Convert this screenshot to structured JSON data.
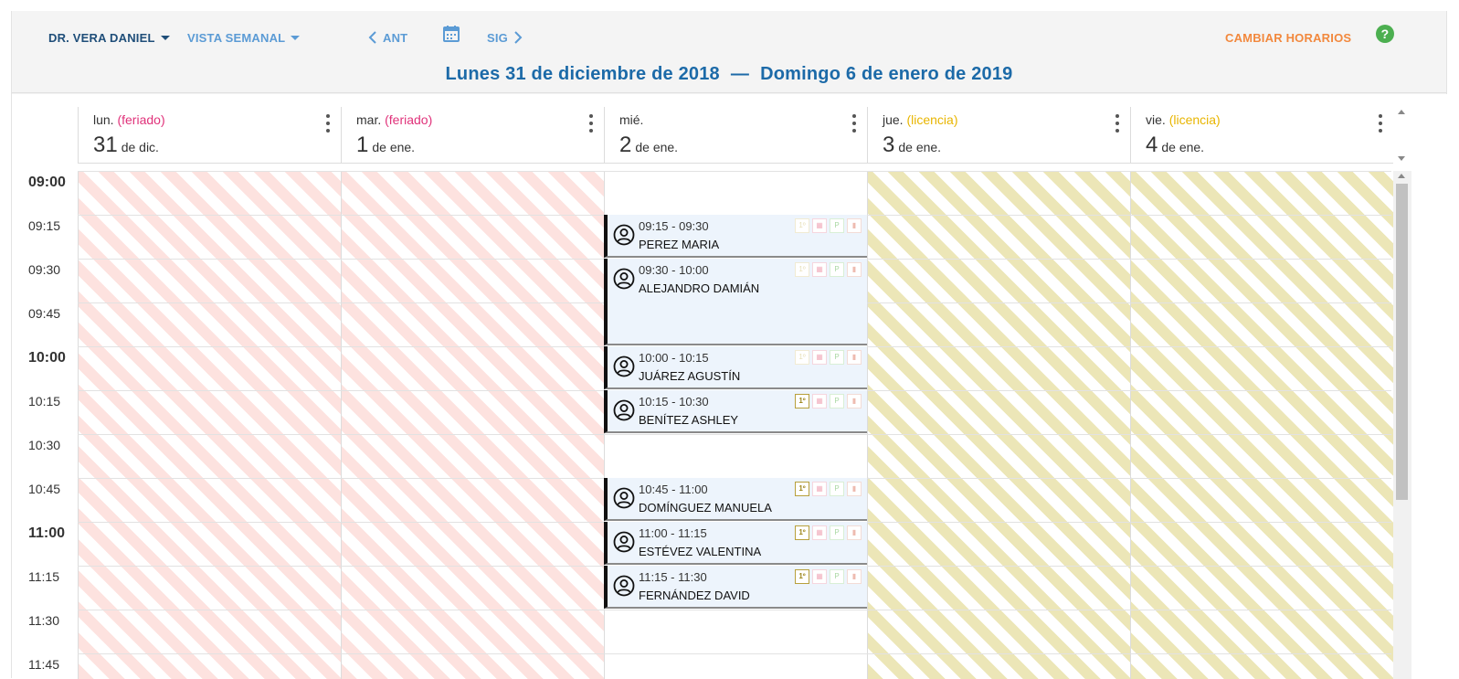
{
  "toolbar": {
    "doctor": "DR. VERA DANIEL",
    "view": "VISTA SEMANAL",
    "prev": "ANT",
    "next": "SIG",
    "change_schedules": "CAMBIAR HORARIOS",
    "help_icon": "question-circle-icon",
    "calendar_icon": "calendar-icon"
  },
  "range": {
    "start": "Lunes 31 de diciembre de 2018",
    "separator": "—",
    "end": "Domingo 6 de enero de 2019"
  },
  "days": [
    {
      "name": "lun.",
      "tag": "(feriado)",
      "num": "31",
      "month": "de dic."
    },
    {
      "name": "mar.",
      "tag": "(feriado)",
      "num": "1",
      "month": "de ene."
    },
    {
      "name": "mié.",
      "tag": "",
      "num": "2",
      "month": "de ene."
    },
    {
      "name": "jue.",
      "tag": "(licencia)",
      "num": "3",
      "month": "de ene."
    },
    {
      "name": "vie.",
      "tag": "(licencia)",
      "num": "4",
      "month": "de ene."
    }
  ],
  "times": [
    "09:00",
    "09:15",
    "09:30",
    "09:45",
    "10:00",
    "10:15",
    "10:30",
    "10:45",
    "11:00",
    "11:15",
    "11:30",
    "11:45"
  ],
  "appointments": [
    {
      "time": "09:15 - 09:30",
      "name": "PEREZ MARIA",
      "first_visit": false
    },
    {
      "time": "09:30 - 10:00",
      "name": "ALEJANDRO DAMIÁN",
      "first_visit": false
    },
    {
      "time": "10:00 - 10:15",
      "name": "JUÁREZ AGUSTÍN",
      "first_visit": false
    },
    {
      "time": "10:15 - 10:30",
      "name": "BENÍTEZ ASHLEY",
      "first_visit": true
    },
    {
      "time": "10:45 - 11:00",
      "name": "DOMÍNGUEZ MANUELA",
      "first_visit": true
    },
    {
      "time": "11:00 - 11:15",
      "name": "ESTÉVEZ VALENTINA",
      "first_visit": true
    },
    {
      "time": "11:15 - 11:30",
      "name": "FERNÁNDEZ DAVID",
      "first_visit": true
    }
  ],
  "badges": [
    "1º",
    "▦",
    "P",
    "▮"
  ],
  "colors": {
    "primary": "#1c6aa8",
    "accent": "#f2883d",
    "holiday": "#e0327a",
    "leave": "#e8b500",
    "help": "#4caf50"
  }
}
